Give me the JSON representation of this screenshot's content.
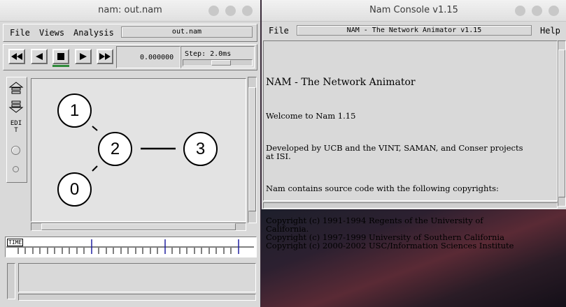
{
  "nam": {
    "title": "nam: out.nam",
    "menu": {
      "file": "File",
      "views": "Views",
      "analysis": "Analysis"
    },
    "filename": "out.nam",
    "playback": {
      "rewind_icon": "fast-rewind-icon",
      "back_icon": "play-back-icon",
      "stop_icon": "stop-icon",
      "play_icon": "play-icon",
      "ff_icon": "fast-forward-icon"
    },
    "time": "0.000000",
    "step_label": "Step: 2.0ms",
    "edit_label": "EDIT",
    "nodes": [
      "1",
      "2",
      "3",
      "0"
    ],
    "timeline_label": "TIME"
  },
  "console": {
    "title": "Nam Console v1.15",
    "menu": {
      "file": "File",
      "help": "Help"
    },
    "header_field": "NAM - The Network Animator v1.15",
    "heading": "NAM - The Network Animator",
    "welcome": "Welcome to Nam 1.15",
    "developed": "Developed by UCB and the VINT, SAMAN, and Conser projects\nat ISI.",
    "copyright_intro": "Nam contains source code with the following copyrights:",
    "copyrights": "Copyright (c) 1991-1994 Regents of the University of\nCalifornia.\nCopyright (c) 1997-1999 University of Southern California\nCopyright (c) 2000-2002 USC/Information Sciences Institute"
  },
  "colors": {
    "accent_green": "#2e8b3a",
    "timeline_blue": "#2020a0"
  }
}
